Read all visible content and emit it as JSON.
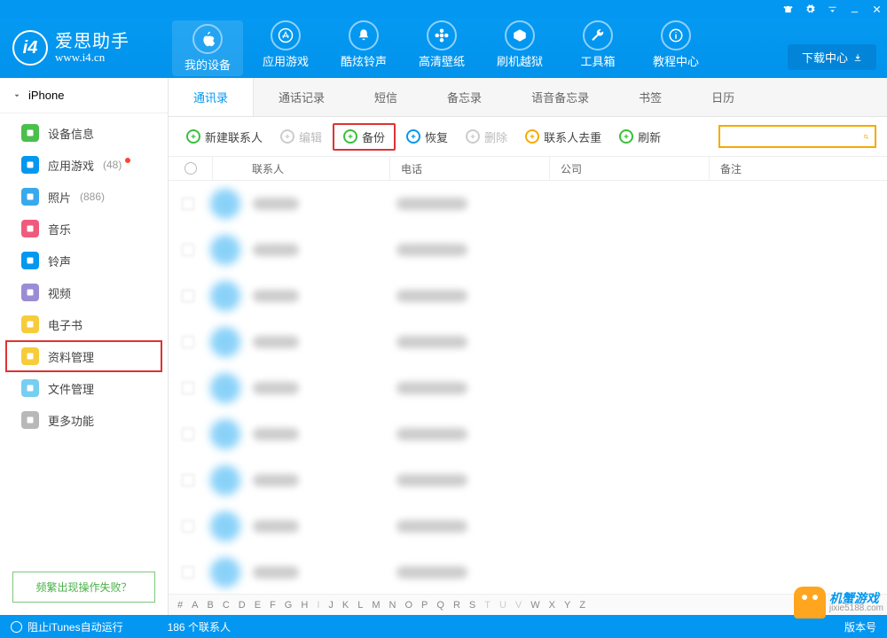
{
  "brand": {
    "name": "爱思助手",
    "url": "www.i4.cn",
    "logo_letter": "i4"
  },
  "window_controls": [
    "tshirt",
    "gear",
    "dropdown",
    "minimize",
    "close"
  ],
  "download_btn": "下载中心",
  "topnav": [
    {
      "label": "我的设备",
      "icon": "apple"
    },
    {
      "label": "应用游戏",
      "icon": "appstore"
    },
    {
      "label": "酷炫铃声",
      "icon": "bell"
    },
    {
      "label": "高清壁纸",
      "icon": "flower"
    },
    {
      "label": "刷机越狱",
      "icon": "box"
    },
    {
      "label": "工具箱",
      "icon": "wrench"
    },
    {
      "label": "教程中心",
      "icon": "info"
    }
  ],
  "device_selector": "iPhone",
  "sidebar": [
    {
      "label": "设备信息",
      "color": "#4bbf4b",
      "badge": ""
    },
    {
      "label": "应用游戏",
      "color": "#0398f0",
      "badge": "(48)",
      "dot": true
    },
    {
      "label": "照片",
      "color": "#39a9ee",
      "badge": "(886)"
    },
    {
      "label": "音乐",
      "color": "#f05b7d"
    },
    {
      "label": "铃声",
      "color": "#0398f0"
    },
    {
      "label": "视频",
      "color": "#9a8dd6"
    },
    {
      "label": "电子书",
      "color": "#f7cc3a"
    },
    {
      "label": "资料管理",
      "color": "#f7cc3a",
      "highlight": true
    },
    {
      "label": "文件管理",
      "color": "#76cef0"
    },
    {
      "label": "更多功能",
      "color": "#b8b8b8"
    }
  ],
  "help_link": "频繁出现操作失败？",
  "subtabs": [
    "通讯录",
    "通话记录",
    "短信",
    "备忘录",
    "语音备忘录",
    "书签",
    "日历"
  ],
  "toolbar": [
    {
      "label": "新建联系人",
      "icon": "plus",
      "color": "#3bbf3b"
    },
    {
      "label": "编辑",
      "icon": "edit",
      "color": "#ccc",
      "disabled": true
    },
    {
      "label": "备份",
      "icon": "backup",
      "color": "#3bbf3b",
      "highlight": true
    },
    {
      "label": "恢复",
      "icon": "restore",
      "color": "#0398f0"
    },
    {
      "label": "删除",
      "icon": "delete",
      "color": "#ccc",
      "disabled": true
    },
    {
      "label": "联系人去重",
      "icon": "dedup",
      "color": "#f7a900"
    },
    {
      "label": "刷新",
      "icon": "refresh",
      "color": "#3bbf3b"
    }
  ],
  "columns": [
    "联系人",
    "电话",
    "公司",
    "备注"
  ],
  "row_count": 9,
  "alpha_index": [
    "#",
    "A",
    "B",
    "C",
    "D",
    "E",
    "F",
    "G",
    "H",
    "I",
    "J",
    "K",
    "L",
    "M",
    "N",
    "O",
    "P",
    "Q",
    "R",
    "S",
    "T",
    "U",
    "V",
    "W",
    "X",
    "Y",
    "Z"
  ],
  "alpha_dim": [
    "I",
    "T",
    "U",
    "V"
  ],
  "statusbar": {
    "left": "阻止iTunes自动运行",
    "center_prefix": "186",
    "center_suffix": " 个联系人",
    "right": "版本号"
  },
  "watermark": {
    "title": "机蟹游戏",
    "sub": "jixie5188.com"
  }
}
